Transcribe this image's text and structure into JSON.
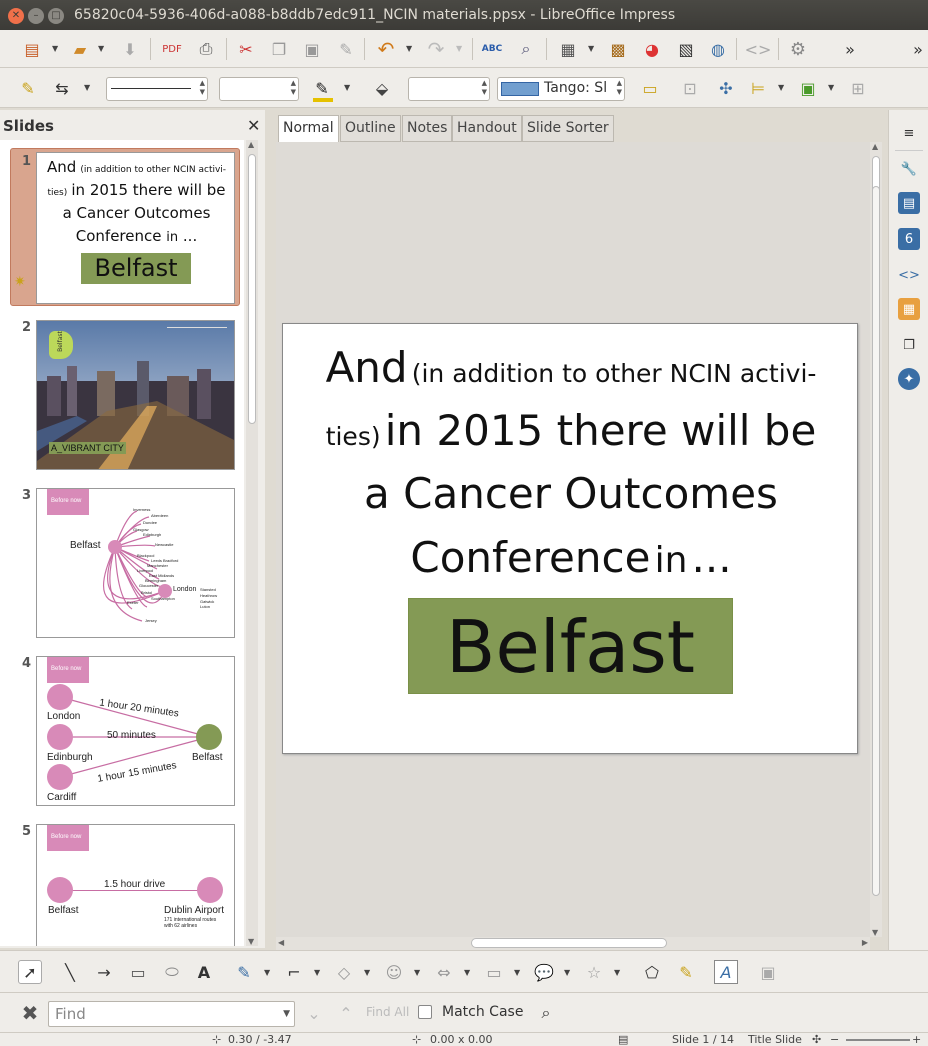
{
  "window": {
    "title": "65820c04-5936-406d-a088-b8ddb7edc911_NCIN materials.ppsx - LibreOffice Impress"
  },
  "toolbar2": {
    "slide_style": "Tango: Sl"
  },
  "slides_pane": {
    "header": "Slides",
    "slides": [
      {
        "number": "1",
        "line1_big": "And",
        "line1_small": "(in addition to other NCIN activi-",
        "line2_small": "ties)",
        "line2_big": "in 2015 there will be",
        "line3": "a Cancer Outcomes",
        "line4": "Conference",
        "line4_small": "in",
        "line4_end": "...",
        "box": "Belfast"
      },
      {
        "number": "2",
        "caption": "A_VIBRANT CITY",
        "logo_text": "Belfast"
      },
      {
        "number": "3",
        "tag": "Before now",
        "hub": "Belfast",
        "dest": "London",
        "cities": [
          "Inverness",
          "Aberdeen",
          "Dundee",
          "Glasgow",
          "Edinburgh",
          "Newcastle",
          "Blackpool",
          "Leeds Bradford",
          "Manchester",
          "Liverpool",
          "East Midlands",
          "Birmingham",
          "Gloucester",
          "Bristol",
          "Southampton",
          "Exeter",
          "Jersey"
        ],
        "london_airports": [
          "Stansted",
          "Heathrow",
          "Gatwick",
          "Luton"
        ]
      },
      {
        "number": "4",
        "tag": "Before now",
        "cities": [
          "London",
          "Edinburgh",
          "Cardiff"
        ],
        "dest": "Belfast",
        "routes": [
          "1 hour 20 minutes",
          "50 minutes",
          "1 hour 15 minutes"
        ]
      },
      {
        "number": "5",
        "tag": "Before now",
        "origin": "Belfast",
        "dest": "Dublin Airport",
        "route": "1.5 hour drive",
        "note_1": "171 international routes",
        "note_2": "with 62 airlines"
      }
    ]
  },
  "view_tabs": [
    "Normal",
    "Outline",
    "Notes",
    "Handout",
    "Slide Sorter"
  ],
  "main_slide": {
    "line1_big": "And",
    "line1_small": "(in addition to other NCIN activi-",
    "line2_small": "ties)",
    "line2_big": "in 2015 there will be",
    "line3": "a Cancer Outcomes",
    "line4": "Conference",
    "line4_small": "in",
    "line4_end": "...",
    "box": "Belfast",
    "box_color": "#849a55"
  },
  "find_bar": {
    "placeholder": "Find",
    "find_all": "Find All",
    "match_case": "Match Case"
  },
  "status_bar": {
    "position": "0.30 / -3.47",
    "size": "0.00 x 0.00",
    "slide": "Slide 1 / 14",
    "layout": "Title Slide"
  }
}
